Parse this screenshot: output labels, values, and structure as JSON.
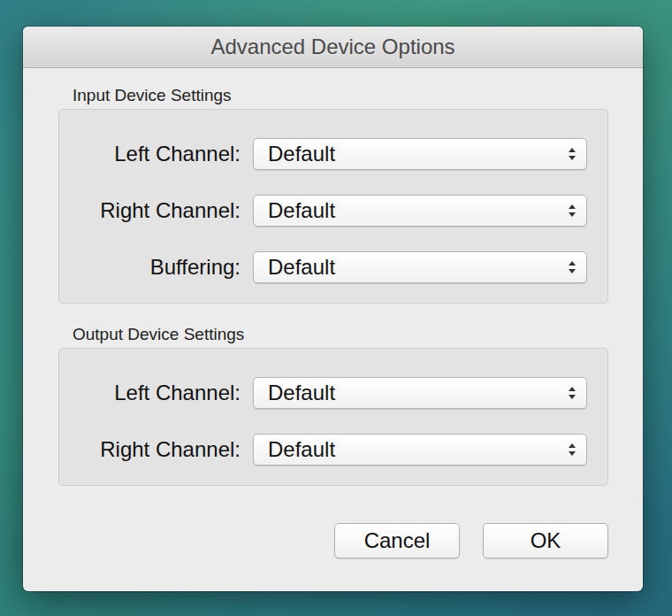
{
  "window": {
    "title": "Advanced Device Options"
  },
  "groups": [
    {
      "label": "Input Device Settings",
      "rows": [
        {
          "label": "Left Channel:",
          "value": "Default"
        },
        {
          "label": "Right Channel:",
          "value": "Default"
        },
        {
          "label": "Buffering:",
          "value": "Default"
        }
      ]
    },
    {
      "label": "Output Device Settings",
      "rows": [
        {
          "label": "Left Channel:",
          "value": "Default"
        },
        {
          "label": "Right Channel:",
          "value": "Default"
        }
      ]
    }
  ],
  "buttons": [
    "Cancel",
    "OK"
  ]
}
